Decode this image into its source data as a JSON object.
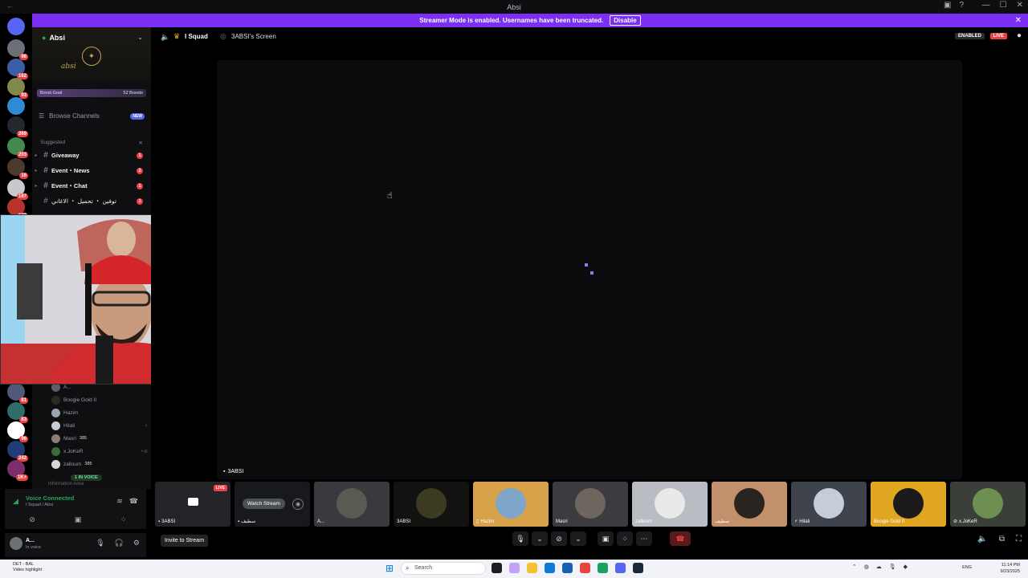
{
  "window": {
    "title": "Absi"
  },
  "banner": {
    "message": "Streamer Mode is enabled. Usernames have been truncated.",
    "disable_label": "Disable"
  },
  "rail": {
    "badges": [
      "98",
      "162",
      "93",
      "",
      "269",
      "203",
      "16",
      "187",
      "109",
      "81",
      "83",
      "96",
      "242",
      "1K+"
    ]
  },
  "guild": {
    "name": "Absi",
    "script": "absi",
    "boost_goal": "Boost Goal",
    "boost_count": "52 Boosts"
  },
  "sidebar": {
    "browse_label": "Browse Channels",
    "new_badge": "NEW",
    "suggested_label": "Suggested",
    "channels": [
      {
        "name": "Giveaway",
        "badge": "1"
      },
      {
        "name": "Event・News",
        "badge": "2"
      },
      {
        "name": "Event・Chat",
        "badge": "1"
      },
      {
        "name": "توفين ・ تحميل ・ الاغاني",
        "badge": "3"
      }
    ],
    "members": [
      {
        "name": "A..."
      },
      {
        "name": "Boogie Gold II"
      },
      {
        "name": "Hazim"
      },
      {
        "name": "Hilali"
      },
      {
        "name": "Masri",
        "tag": "385"
      },
      {
        "name": "x.JoKeR"
      },
      {
        "name": "zalloum",
        "tag": "385"
      }
    ],
    "in_voice": "1 IN VOICE",
    "info_area": "Information Area"
  },
  "voice_panel": {
    "status": "Voice Connected",
    "location": "I Squad / Absi"
  },
  "user": {
    "name": "A...",
    "status": "In voice"
  },
  "topbar": {
    "channel": "I Squad",
    "screen": "3ABSI's Screen",
    "enabled_label": "ENABLED",
    "live_label": "LIVE"
  },
  "stage": {
    "label": "3ABSI"
  },
  "strip": {
    "live_badge": "LIVE",
    "watch_label": "Watch Stream",
    "tiles": [
      {
        "name": "3ABSI"
      },
      {
        "name": "سطيف"
      },
      {
        "name": "A..."
      },
      {
        "name": "3ABSI"
      },
      {
        "name": "Hazim"
      },
      {
        "name": "Masri"
      },
      {
        "name": "zalloum"
      },
      {
        "name": "سطيف"
      },
      {
        "name": "Hilali"
      },
      {
        "name": "Boogie Gold II"
      },
      {
        "name": "x.JoKeR"
      }
    ]
  },
  "controls": {
    "invite_label": "Invite to Stream"
  },
  "taskbar": {
    "weather_line1": "DET - BAL",
    "weather_line2": "Video highlight",
    "search_placeholder": "Search",
    "lang": "ENG",
    "time": "11:14 PM",
    "date": "9/23/2025"
  },
  "colors": {
    "accent": "#7a2ff3",
    "live": "#ed4245",
    "voice_green": "#23a55a",
    "blurple": "#5865f2"
  }
}
